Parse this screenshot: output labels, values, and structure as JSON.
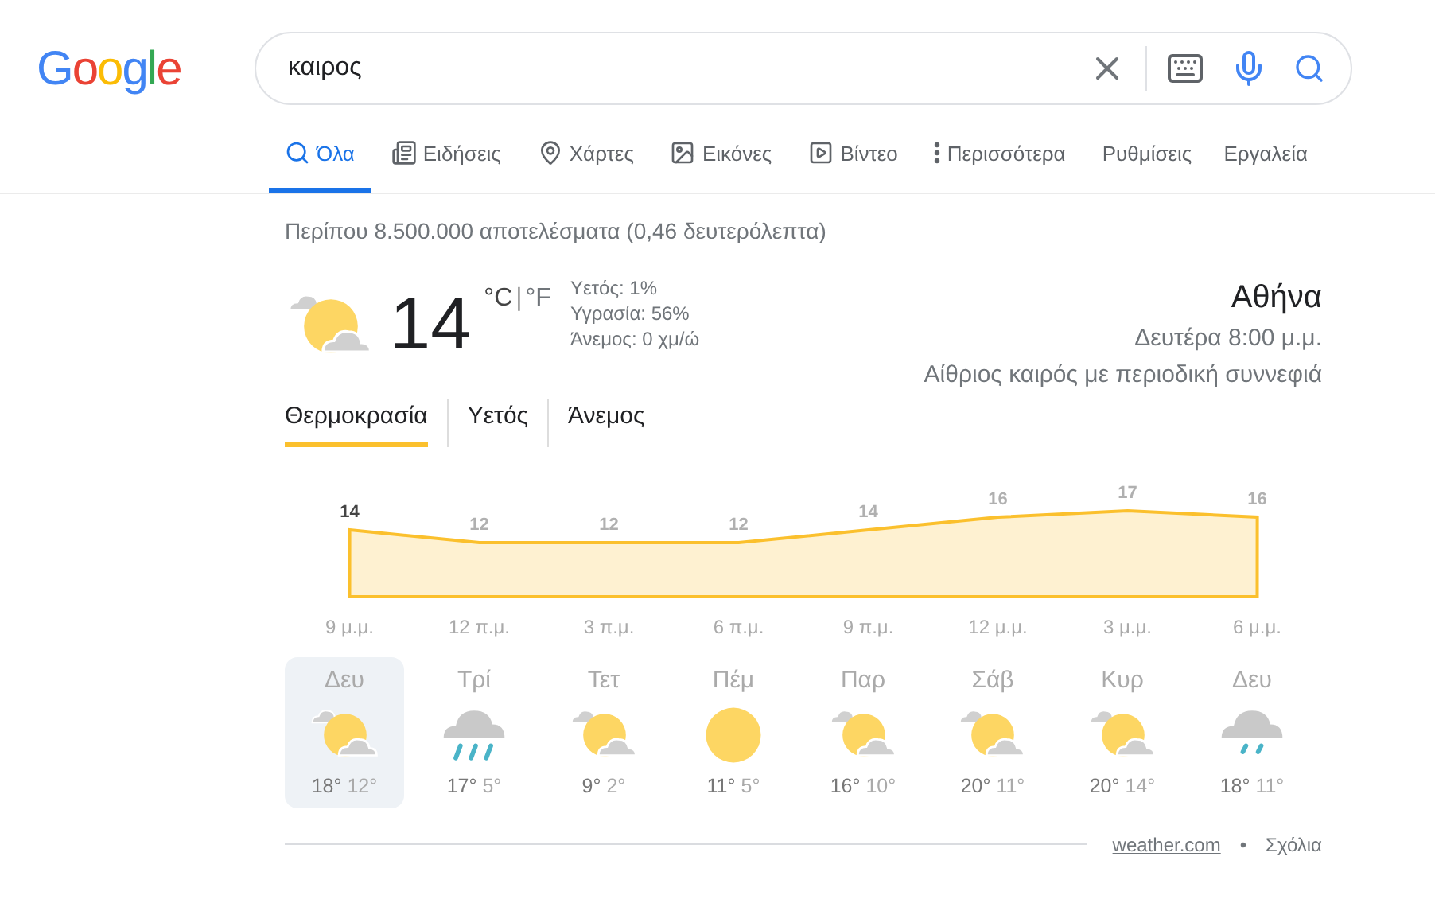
{
  "logo": "Google",
  "search": {
    "value": "καιρος"
  },
  "tabs": [
    {
      "label": "Όλα",
      "kind": "search",
      "selected": true
    },
    {
      "label": "Ειδήσεις",
      "kind": "news",
      "selected": false
    },
    {
      "label": "Χάρτες",
      "kind": "pin",
      "selected": false
    },
    {
      "label": "Εικόνες",
      "kind": "image",
      "selected": false
    },
    {
      "label": "Βίντεο",
      "kind": "play",
      "selected": false
    },
    {
      "label": "Περισσότερα",
      "kind": "more",
      "selected": false
    }
  ],
  "tools": [
    "Ρυθμίσεις",
    "Εργαλεία"
  ],
  "result_stats": "Περίπου 8.500.000 αποτελέσματα (0,46 δευτερόλεπτα)",
  "weather": {
    "temperature": "14",
    "unit_c": "°C",
    "unit_sep": "|",
    "unit_f": "°F",
    "details": [
      "Υετός: 1%",
      "Υγρασία: 56%",
      "Άνεμος: 0 χμ/ώ"
    ],
    "location": "Αθήνα",
    "time": "Δευτέρα 8:00 μ.μ.",
    "condition": "Αίθριος καιρός με περιοδική συννεφιά",
    "views": [
      {
        "label": "Θερμοκρασία",
        "selected": true
      },
      {
        "label": "Υετός",
        "selected": false
      },
      {
        "label": "Άνεμος",
        "selected": false
      }
    ],
    "chart_data": {
      "type": "area",
      "categories": [
        "9 μ.μ.",
        "12 π.μ.",
        "3 π.μ.",
        "6 π.μ.",
        "9 π.μ.",
        "12 μ.μ.",
        "3 μ.μ.",
        "6 μ.μ."
      ],
      "series": [
        {
          "color": "#fbc02d",
          "values": [
            14,
            12,
            12,
            12,
            14,
            16,
            17,
            16
          ]
        }
      ],
      "data_labels": true
    },
    "days": [
      {
        "day": "Δευ",
        "kind": "partly_cloudy",
        "high": "18°",
        "low": "12°",
        "selected": true
      },
      {
        "day": "Τρί",
        "kind": "rain",
        "high": "17°",
        "low": "5°",
        "selected": false
      },
      {
        "day": "Τετ",
        "kind": "partly_cloudy",
        "high": "9°",
        "low": "2°",
        "selected": false
      },
      {
        "day": "Πέμ",
        "kind": "sunny",
        "high": "11°",
        "low": "5°",
        "selected": false
      },
      {
        "day": "Παρ",
        "kind": "partly_cloudy",
        "high": "16°",
        "low": "10°",
        "selected": false
      },
      {
        "day": "Σάβ",
        "kind": "partly_cloudy",
        "high": "20°",
        "low": "11°",
        "selected": false
      },
      {
        "day": "Κυρ",
        "kind": "partly_cloudy",
        "high": "20°",
        "low": "14°",
        "selected": false
      },
      {
        "day": "Δευ",
        "kind": "showers",
        "high": "18°",
        "low": "11°",
        "selected": false
      }
    ],
    "source": "weather.com",
    "separator": "•",
    "feedback": "Σχόλια"
  }
}
